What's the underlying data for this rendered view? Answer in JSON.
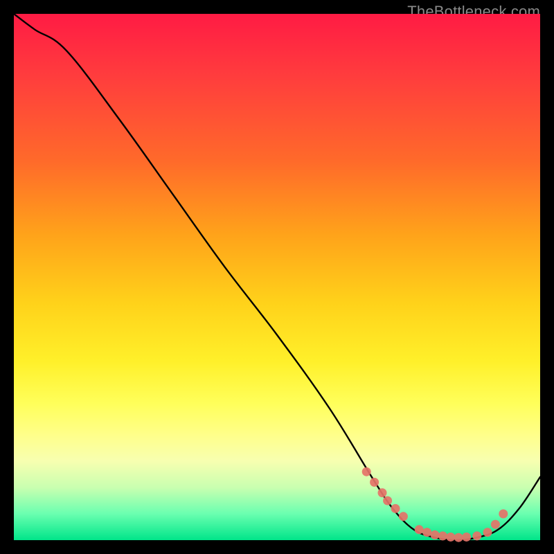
{
  "watermark": "TheBottleneck.com",
  "chart_data": {
    "type": "line",
    "title": "",
    "xlabel": "",
    "ylabel": "",
    "xlim": [
      0,
      100
    ],
    "ylim": [
      0,
      100
    ],
    "series": [
      {
        "name": "curve",
        "x": [
          0,
          4,
          10,
          20,
          30,
          40,
          50,
          60,
          68,
          72,
          76,
          80,
          84,
          88,
          92,
          96,
          100
        ],
        "y": [
          100,
          97,
          93,
          80,
          66,
          52,
          39,
          25,
          12,
          6,
          2,
          0.5,
          0,
          0.5,
          2,
          6,
          12
        ]
      }
    ],
    "markers": {
      "name": "highlight-points",
      "color": "#e57368",
      "x": [
        67,
        68.5,
        70,
        71,
        72.5,
        74,
        77,
        78.5,
        80,
        81.5,
        83,
        84.5,
        86,
        88,
        90,
        91.5,
        93
      ],
      "y": [
        13,
        11,
        9,
        7.5,
        6,
        4.5,
        2,
        1.5,
        1,
        0.8,
        0.6,
        0.5,
        0.6,
        0.8,
        1.5,
        3,
        5
      ]
    }
  }
}
